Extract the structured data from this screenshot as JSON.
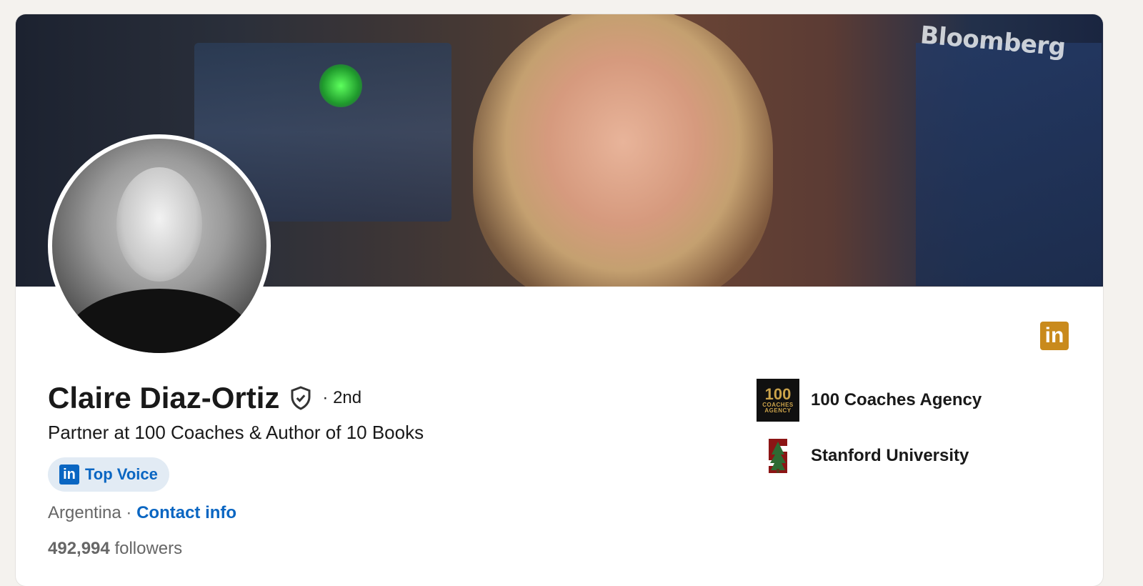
{
  "banner": {
    "brand": "Bloomberg"
  },
  "profile": {
    "name": "Claire Diaz-Ortiz",
    "degree": "· 2nd",
    "headline": "Partner at 100 Coaches & Author of 10 Books",
    "badge": {
      "label": "Top Voice",
      "icon": "linkedin-icon"
    },
    "location": "Argentina",
    "separator": " · ",
    "contact_label": "Contact info",
    "followers_count": "492,994",
    "followers_label": "followers"
  },
  "experience": [
    {
      "name": "100 Coaches Agency",
      "logo_text_top": "100",
      "logo_text_mid": "COACHES",
      "logo_text_bottom": "AGENCY"
    }
  ],
  "education": [
    {
      "name": "Stanford University",
      "logo_icon": "stanford-s-icon"
    }
  ],
  "icons": {
    "linkedin_corner": "in",
    "linkedin_badge": "in",
    "verified": "shield-check-icon"
  },
  "colors": {
    "accent": "#0a66c2",
    "linkedin_gold": "#c98a1c",
    "badge_bg": "#e2ebf4"
  }
}
